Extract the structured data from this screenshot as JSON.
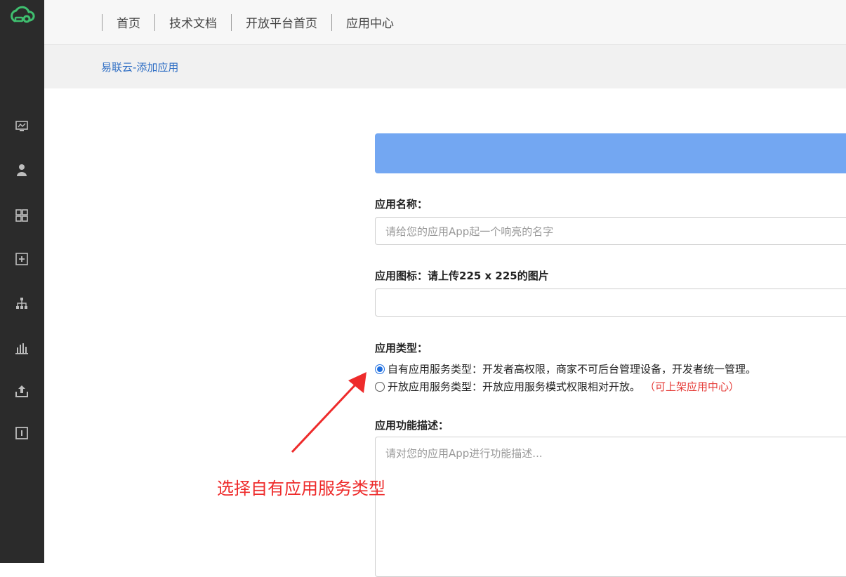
{
  "nav": {
    "items": [
      "首页",
      "技术文档",
      "开放平台首页",
      "应用中心"
    ]
  },
  "breadcrumb": "易联云-添加应用",
  "form": {
    "name_label": "应用名称：",
    "name_placeholder": "请给您的应用App起一个响亮的名字",
    "icon_label": "应用图标：请上传225 x 225的图片",
    "type_label": "应用类型：",
    "types": [
      {
        "label": "自有应用服务类型：开发者高权限，商家不可后台管理设备，开发者统一管理。",
        "checked": true,
        "note": ""
      },
      {
        "label": "开放应用服务类型：开放应用服务模式权限相对开放。",
        "checked": false,
        "note": "（可上架应用中心）"
      }
    ],
    "desc_label": "应用功能描述：",
    "desc_placeholder": "请对您的应用App进行功能描述..."
  },
  "annotation": "选择自有应用服务类型",
  "icons": [
    "logo-cloud-icon",
    "monitor-icon",
    "user-icon",
    "grid-icon",
    "add-box-icon",
    "sitemap-icon",
    "bar-chart-icon",
    "upload-icon",
    "info-box-icon"
  ],
  "colors": {
    "sidebar": "#2b2b2b",
    "accent_green": "#3fbf6f",
    "banner": "#73a7f2",
    "link": "#2d6dc4",
    "annotation": "#ee2b2b"
  }
}
